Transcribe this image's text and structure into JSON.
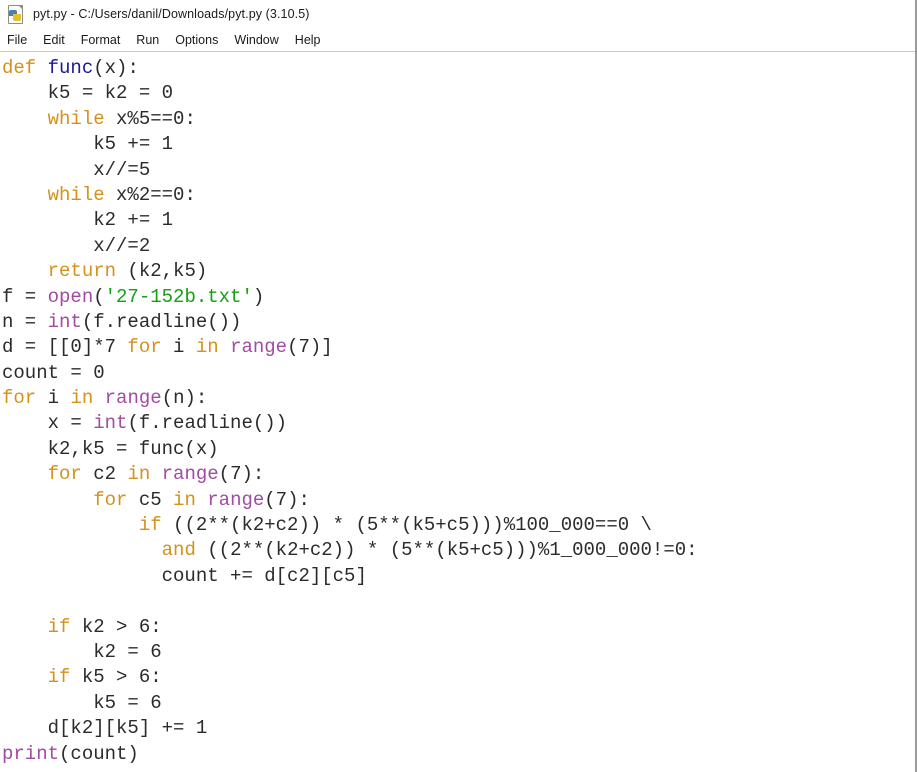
{
  "window": {
    "icon": "python-file-icon",
    "title": "pyt.py - C:/Users/danil/Downloads/pyt.py (3.10.5)"
  },
  "menubar": {
    "items": [
      {
        "label": "File"
      },
      {
        "label": "Edit"
      },
      {
        "label": "Format"
      },
      {
        "label": "Run"
      },
      {
        "label": "Options"
      },
      {
        "label": "Window"
      },
      {
        "label": "Help"
      }
    ]
  },
  "colors": {
    "keyword": "#d4921b",
    "definition": "#1b1b8f",
    "builtin": "#a24ba2",
    "string": "#14a014",
    "text": "#2b2b2b",
    "background": "#ffffff"
  },
  "editor": {
    "code_lines": [
      "def func(x):",
      "    k5 = k2 = 0",
      "    while x%5==0:",
      "        k5 += 1",
      "        x//=5",
      "    while x%2==0:",
      "        k2 += 1",
      "        x//=2",
      "    return (k2,k5)",
      "f = open('27-152b.txt')",
      "n = int(f.readline())",
      "d = [[0]*7 for i in range(7)]",
      "count = 0",
      "for i in range(n):",
      "    x = int(f.readline())",
      "    k2,k5 = func(x)",
      "    for c2 in range(7):",
      "        for c5 in range(7):",
      "            if ((2**(k2+c2)) * (5**(k5+c5)))%100_000==0 \\",
      "              and ((2**(k2+c2)) * (5**(k5+c5)))%1_000_000!=0:",
      "              count += d[c2][c5]",
      "",
      "    if k2 > 6:",
      "        k2 = 6",
      "    if k5 > 6:",
      "        k5 = 6",
      "    d[k2][k5] += 1",
      "print(count)"
    ],
    "tokens": [
      [
        {
          "t": "def",
          "c": "kw"
        },
        {
          "t": " ",
          "c": ""
        },
        {
          "t": "func",
          "c": "def"
        },
        {
          "t": "(x):",
          "c": ""
        }
      ],
      [
        {
          "t": "    k5 = k2 = 0",
          "c": ""
        }
      ],
      [
        {
          "t": "    ",
          "c": ""
        },
        {
          "t": "while",
          "c": "kw"
        },
        {
          "t": " x%5==0:",
          "c": ""
        }
      ],
      [
        {
          "t": "        k5 += 1",
          "c": ""
        }
      ],
      [
        {
          "t": "        x//=5",
          "c": ""
        }
      ],
      [
        {
          "t": "    ",
          "c": ""
        },
        {
          "t": "while",
          "c": "kw"
        },
        {
          "t": " x%2==0:",
          "c": ""
        }
      ],
      [
        {
          "t": "        k2 += 1",
          "c": ""
        }
      ],
      [
        {
          "t": "        x//=2",
          "c": ""
        }
      ],
      [
        {
          "t": "    ",
          "c": ""
        },
        {
          "t": "return",
          "c": "kw"
        },
        {
          "t": " (k2,k5)",
          "c": ""
        }
      ],
      [
        {
          "t": "f = ",
          "c": ""
        },
        {
          "t": "open",
          "c": "bi"
        },
        {
          "t": "(",
          "c": ""
        },
        {
          "t": "'27-152b.txt'",
          "c": "str"
        },
        {
          "t": ")",
          "c": ""
        }
      ],
      [
        {
          "t": "n = ",
          "c": ""
        },
        {
          "t": "int",
          "c": "bi"
        },
        {
          "t": "(f.readline())",
          "c": ""
        }
      ],
      [
        {
          "t": "d = [[0]*7 ",
          "c": ""
        },
        {
          "t": "for",
          "c": "kw"
        },
        {
          "t": " i ",
          "c": ""
        },
        {
          "t": "in",
          "c": "kw"
        },
        {
          "t": " ",
          "c": ""
        },
        {
          "t": "range",
          "c": "bi"
        },
        {
          "t": "(7)]",
          "c": ""
        }
      ],
      [
        {
          "t": "count = 0",
          "c": ""
        }
      ],
      [
        {
          "t": "for",
          "c": "kw"
        },
        {
          "t": " i ",
          "c": ""
        },
        {
          "t": "in",
          "c": "kw"
        },
        {
          "t": " ",
          "c": ""
        },
        {
          "t": "range",
          "c": "bi"
        },
        {
          "t": "(n):",
          "c": ""
        }
      ],
      [
        {
          "t": "    x = ",
          "c": ""
        },
        {
          "t": "int",
          "c": "bi"
        },
        {
          "t": "(f.readline())",
          "c": ""
        }
      ],
      [
        {
          "t": "    k2,k5 = func(x)",
          "c": ""
        }
      ],
      [
        {
          "t": "    ",
          "c": ""
        },
        {
          "t": "for",
          "c": "kw"
        },
        {
          "t": " c2 ",
          "c": ""
        },
        {
          "t": "in",
          "c": "kw"
        },
        {
          "t": " ",
          "c": ""
        },
        {
          "t": "range",
          "c": "bi"
        },
        {
          "t": "(7):",
          "c": ""
        }
      ],
      [
        {
          "t": "        ",
          "c": ""
        },
        {
          "t": "for",
          "c": "kw"
        },
        {
          "t": " c5 ",
          "c": ""
        },
        {
          "t": "in",
          "c": "kw"
        },
        {
          "t": " ",
          "c": ""
        },
        {
          "t": "range",
          "c": "bi"
        },
        {
          "t": "(7):",
          "c": ""
        }
      ],
      [
        {
          "t": "            ",
          "c": ""
        },
        {
          "t": "if",
          "c": "kw"
        },
        {
          "t": " ((2**(k2+c2)) * (5**(k5+c5)))%100_000==0 \\",
          "c": ""
        }
      ],
      [
        {
          "t": "              ",
          "c": ""
        },
        {
          "t": "and",
          "c": "kw"
        },
        {
          "t": " ((2**(k2+c2)) * (5**(k5+c5)))%1_000_000!=0:",
          "c": ""
        }
      ],
      [
        {
          "t": "              count += d[c2][c5]",
          "c": ""
        }
      ],
      [
        {
          "t": "",
          "c": ""
        }
      ],
      [
        {
          "t": "    ",
          "c": ""
        },
        {
          "t": "if",
          "c": "kw"
        },
        {
          "t": " k2 > 6:",
          "c": ""
        }
      ],
      [
        {
          "t": "        k2 = 6",
          "c": ""
        }
      ],
      [
        {
          "t": "    ",
          "c": ""
        },
        {
          "t": "if",
          "c": "kw"
        },
        {
          "t": " k5 > 6:",
          "c": ""
        }
      ],
      [
        {
          "t": "        k5 = 6",
          "c": ""
        }
      ],
      [
        {
          "t": "    d[k2][k5] += 1",
          "c": ""
        }
      ],
      [
        {
          "t": "print",
          "c": "bi"
        },
        {
          "t": "(count)",
          "c": ""
        }
      ]
    ]
  }
}
